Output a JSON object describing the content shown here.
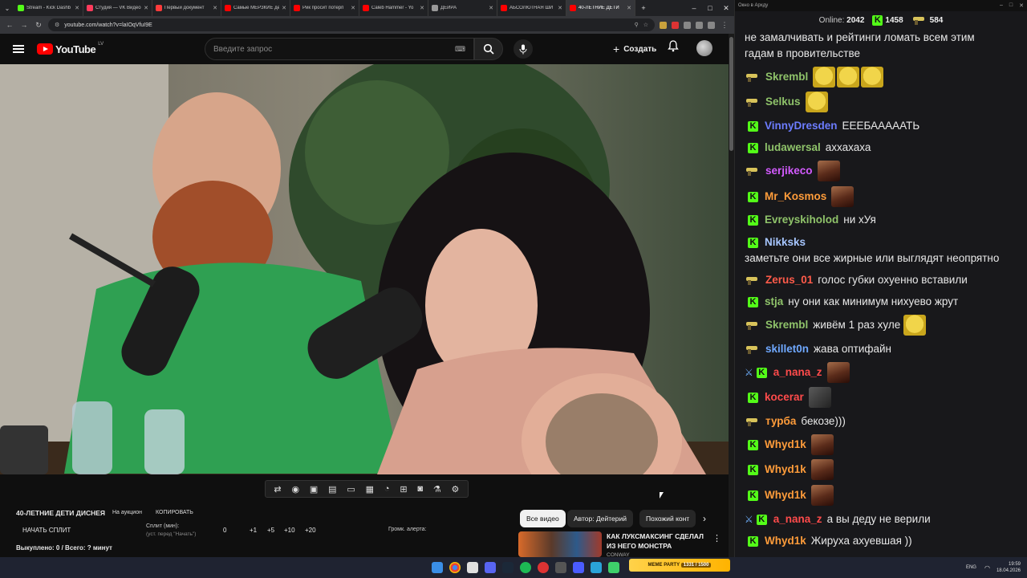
{
  "browser": {
    "tabs": [
      {
        "label": "Stream - Kick Dashb",
        "color": "#53fc18"
      },
      {
        "label": "Студия — VK Видео",
        "color": "#ff3b5c"
      },
      {
        "label": "Первый документ",
        "color": "#ff3b3b"
      },
      {
        "label": "Самые МЕРЗКИЕ де",
        "color": "#ff0000"
      },
      {
        "label": "Рик просит потерп",
        "color": "#ff0000"
      },
      {
        "label": "Caleb Hammer - Yo",
        "color": "#ff0000"
      },
      {
        "label": "ДЕИРА",
        "color": "#999999"
      },
      {
        "label": "АБСОЛЮТНАЯ ШИ",
        "color": "#ff0000"
      },
      {
        "label": "40-ЛЕТНИЕ ДЕТИ",
        "color": "#ff0000"
      }
    ],
    "url": "youtube.com/watch?v=laIOqVfuI9E"
  },
  "youtube": {
    "logo_word": "YouTube",
    "region": "LV",
    "search_placeholder": "Введите запрос",
    "create_label": "Создать"
  },
  "overlay": {
    "title": "40-ЛЕТНИЕ ДЕТИ ДИСНЕЯ",
    "auction": "На аукцион",
    "copy": "КОПИРОВАТЬ",
    "start_split": "НАЧАТЬ СПЛИТ",
    "split_label": "Сплит (мин):",
    "split_hint": "(уст. перед \"Начать\")",
    "split_values": [
      "0",
      "+1",
      "+5",
      "+10",
      "+20"
    ],
    "loud_label": "Громк. алерта:",
    "bought": "Выкуплено: 0 / Всего: ? минут"
  },
  "chips": [
    "Все видео",
    "Автор: Дейтерий",
    "Похожий конт"
  ],
  "rec": {
    "title_line1": "КАК ЛУКСМАКСИНГ СДЕЛАЛ",
    "title_line2": "ИЗ НЕГО МОНСТРА",
    "channel": "CONWAY"
  },
  "chat": {
    "window_title": "Окно в Архду",
    "online_label": "Online:",
    "online": "2042",
    "kick_count": "1458",
    "other_count": "584",
    "messages": [
      {
        "text": "не замалчивать и рейтинги ломать всем этим гадам в провительстве"
      },
      {
        "user": "Skrembl",
        "color": "#8fc36a",
        "badge": "gun",
        "text": "",
        "emotes": [
          "pepe",
          "pepe",
          "pepe"
        ]
      },
      {
        "user": "Selkus",
        "color": "#8fc36a",
        "badge": "gun",
        "text": "",
        "emotes": [
          "pepe"
        ]
      },
      {
        "user": "VinnyDresden",
        "color": "#6c7cff",
        "badge": "k",
        "text": "ЕЕЕБАААААТЬ"
      },
      {
        "user": "ludawersal",
        "color": "#8fc36a",
        "badge": "k",
        "text": "аххахаха"
      },
      {
        "user": "serjikeco",
        "color": "#d35bff",
        "badge": "gun",
        "text": "",
        "emotes": [
          "face"
        ]
      },
      {
        "user": "Mr_Kosmos",
        "color": "#ff9c3a",
        "badge": "k",
        "text": "",
        "emotes": [
          "face"
        ]
      },
      {
        "user": "Evreyskiholod",
        "color": "#8fc36a",
        "badge": "k",
        "text": "ни хУя"
      },
      {
        "user": "Nikksks",
        "color": "#a7c6ff",
        "badge": "k",
        "text": "заметьте они все жирные или выглядят неопрятно"
      },
      {
        "user": "Zerus_01",
        "color": "#ff5b4a",
        "badge": "gun",
        "text": "голос губки охуенно вставили"
      },
      {
        "user": "stja",
        "color": "#8fc36a",
        "badge": "k",
        "text": "ну они как минимум нихуево жрут"
      },
      {
        "user": "Skrembl",
        "color": "#8fc36a",
        "badge": "gun",
        "text": "живём 1 раз хуле",
        "emotes": [
          "pepe"
        ]
      },
      {
        "user": "skillet0n",
        "color": "#6fa8ff",
        "badge": "gun",
        "text": "жава оптифайн"
      },
      {
        "user": "a_nana_z",
        "color": "#ff4b4b",
        "badge": "sword",
        "text": "",
        "emotes": [
          "face"
        ]
      },
      {
        "user": "kocerar",
        "color": "#ff4b4b",
        "badge": "k",
        "text": "",
        "emotes": [
          "gray"
        ]
      },
      {
        "user": "турба",
        "color": "#ff9c3a",
        "badge": "gun",
        "text": "бекозе)))"
      },
      {
        "user": "Whyd1k",
        "color": "#ff9c3a",
        "badge": "k",
        "text": "",
        "emotes": [
          "face"
        ]
      },
      {
        "user": "Whyd1k",
        "color": "#ff9c3a",
        "badge": "k",
        "text": "",
        "emotes": [
          "face"
        ]
      },
      {
        "user": "Whyd1k",
        "color": "#ff9c3a",
        "badge": "k",
        "text": "",
        "emotes": [
          "face"
        ]
      },
      {
        "user": "a_nana_z",
        "color": "#ff4b4b",
        "badge": "sword",
        "text": "а вы деду не верили"
      },
      {
        "user": "Whyd1k",
        "color": "#ff9c3a",
        "badge": "k",
        "text": "Жируха ахуевшая ))"
      }
    ]
  },
  "taskbar": {
    "lang": "ENG",
    "time": "19:59",
    "date": "18.04.2026",
    "meme_label": "MEME PARTY",
    "meme_value": "1331 / 1500"
  }
}
